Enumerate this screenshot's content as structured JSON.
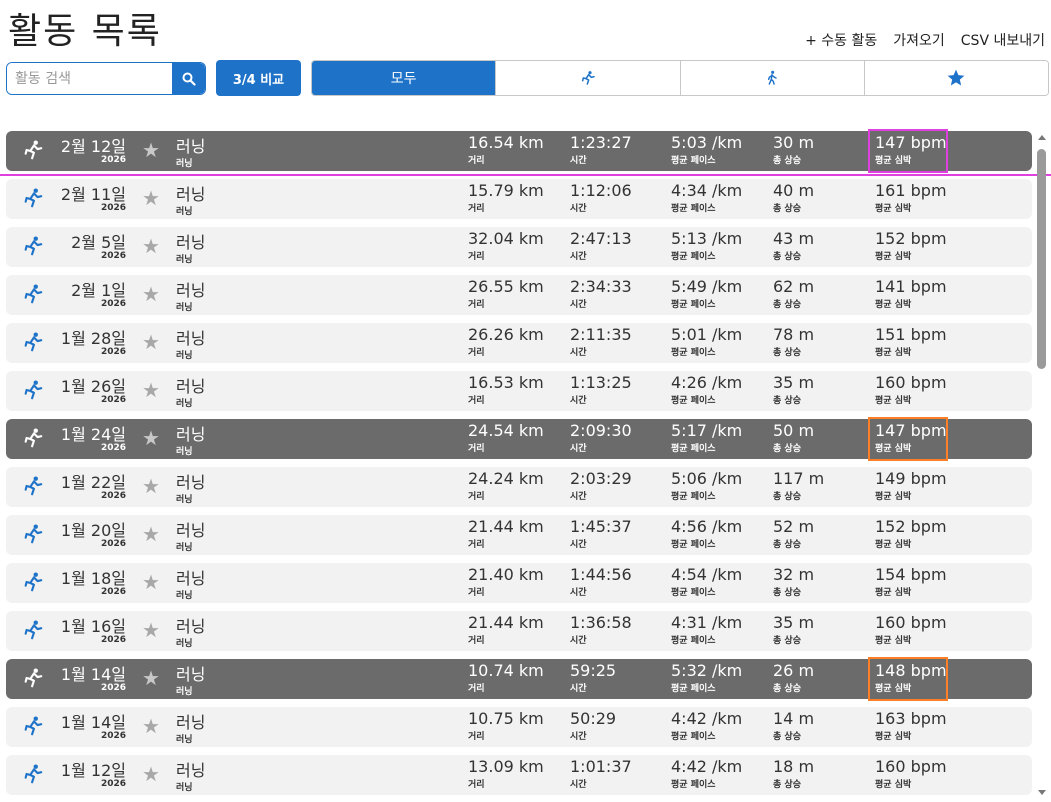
{
  "page_title": "활동 목록",
  "actions": {
    "manual": "+ 수동 활동",
    "import": "가져오기",
    "export": "CSV 내보내기"
  },
  "search": {
    "placeholder": "활동 검색",
    "value": ""
  },
  "compare_label": "3/4 비교",
  "filters": {
    "all": "모두",
    "run_icon": "running-icon",
    "walk_icon": "walking-icon",
    "fav_icon": "star-icon",
    "active": "all"
  },
  "labels": {
    "distance": "거리",
    "time": "시간",
    "pace": "평균 페이스",
    "elevation": "총 상승",
    "heart_rate": "평균 심박"
  },
  "colors": {
    "accent": "#1e73c9",
    "selected_row": "#6b6b6b",
    "orange_highlight": "#ff7f27",
    "magenta_highlight": "#e040e0"
  },
  "activities": [
    {
      "date": "2월 12일",
      "year": "2026",
      "name": "러닝",
      "sub": "러닝",
      "distance": "16.54 km",
      "time": "1:23:27",
      "pace": "5:03 /km",
      "elevation": "30 m",
      "hr": "147 bpm",
      "selected": true,
      "highlight": "magenta"
    },
    {
      "date": "2월 11일",
      "year": "2026",
      "name": "러닝",
      "sub": "러닝",
      "distance": "15.79 km",
      "time": "1:12:06",
      "pace": "4:34 /km",
      "elevation": "40 m",
      "hr": "161 bpm",
      "selected": false,
      "highlight": ""
    },
    {
      "date": "2월 5일",
      "year": "2026",
      "name": "러닝",
      "sub": "러닝",
      "distance": "32.04 km",
      "time": "2:47:13",
      "pace": "5:13 /km",
      "elevation": "43 m",
      "hr": "152 bpm",
      "selected": false,
      "highlight": ""
    },
    {
      "date": "2월 1일",
      "year": "2026",
      "name": "러닝",
      "sub": "러닝",
      "distance": "26.55 km",
      "time": "2:34:33",
      "pace": "5:49 /km",
      "elevation": "62 m",
      "hr": "141 bpm",
      "selected": false,
      "highlight": ""
    },
    {
      "date": "1월 28일",
      "year": "2026",
      "name": "러닝",
      "sub": "러닝",
      "distance": "26.26 km",
      "time": "2:11:35",
      "pace": "5:01 /km",
      "elevation": "78 m",
      "hr": "151 bpm",
      "selected": false,
      "highlight": ""
    },
    {
      "date": "1월 26일",
      "year": "2026",
      "name": "러닝",
      "sub": "러닝",
      "distance": "16.53 km",
      "time": "1:13:25",
      "pace": "4:26 /km",
      "elevation": "35 m",
      "hr": "160 bpm",
      "selected": false,
      "highlight": ""
    },
    {
      "date": "1월 24일",
      "year": "2026",
      "name": "러닝",
      "sub": "러닝",
      "distance": "24.54 km",
      "time": "2:09:30",
      "pace": "5:17 /km",
      "elevation": "50 m",
      "hr": "147 bpm",
      "selected": true,
      "highlight": "orange"
    },
    {
      "date": "1월 22일",
      "year": "2026",
      "name": "러닝",
      "sub": "러닝",
      "distance": "24.24 km",
      "time": "2:03:29",
      "pace": "5:06 /km",
      "elevation": "117 m",
      "hr": "149 bpm",
      "selected": false,
      "highlight": ""
    },
    {
      "date": "1월 20일",
      "year": "2026",
      "name": "러닝",
      "sub": "러닝",
      "distance": "21.44 km",
      "time": "1:45:37",
      "pace": "4:56 /km",
      "elevation": "52 m",
      "hr": "152 bpm",
      "selected": false,
      "highlight": ""
    },
    {
      "date": "1월 18일",
      "year": "2026",
      "name": "러닝",
      "sub": "러닝",
      "distance": "21.40 km",
      "time": "1:44:56",
      "pace": "4:54 /km",
      "elevation": "32 m",
      "hr": "154 bpm",
      "selected": false,
      "highlight": ""
    },
    {
      "date": "1월 16일",
      "year": "2026",
      "name": "러닝",
      "sub": "러닝",
      "distance": "21.44 km",
      "time": "1:36:58",
      "pace": "4:31 /km",
      "elevation": "35 m",
      "hr": "160 bpm",
      "selected": false,
      "highlight": ""
    },
    {
      "date": "1월 14일",
      "year": "2026",
      "name": "러닝",
      "sub": "러닝",
      "distance": "10.74 km",
      "time": "59:25",
      "pace": "5:32 /km",
      "elevation": "26 m",
      "hr": "148 bpm",
      "selected": true,
      "highlight": "orange"
    },
    {
      "date": "1월 14일",
      "year": "2026",
      "name": "러닝",
      "sub": "러닝",
      "distance": "10.75 km",
      "time": "50:29",
      "pace": "4:42 /km",
      "elevation": "14 m",
      "hr": "163 bpm",
      "selected": false,
      "highlight": ""
    },
    {
      "date": "1월 12일",
      "year": "2026",
      "name": "러닝",
      "sub": "러닝",
      "distance": "13.09 km",
      "time": "1:01:37",
      "pace": "4:42 /km",
      "elevation": "18 m",
      "hr": "160 bpm",
      "selected": false,
      "highlight": ""
    }
  ]
}
